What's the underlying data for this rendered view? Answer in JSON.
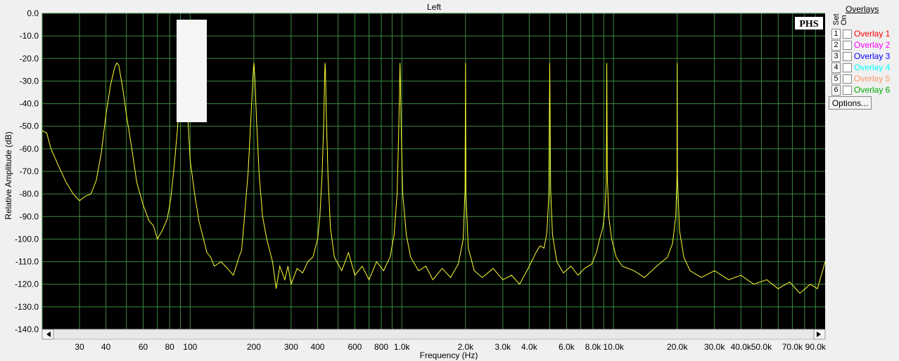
{
  "window": {
    "channel_title": "Left"
  },
  "badge": {
    "text": "PHS"
  },
  "overlays": {
    "title": "Overlays",
    "set_header": "Set",
    "on_header": "On",
    "items": [
      {
        "num": "1",
        "label": "Overlay 1",
        "color": "#ff0000"
      },
      {
        "num": "2",
        "label": "Overlay 2",
        "color": "#ff00ff"
      },
      {
        "num": "3",
        "label": "Overlay 3",
        "color": "#0000ff"
      },
      {
        "num": "4",
        "label": "Overlay 4",
        "color": "#00ffff"
      },
      {
        "num": "5",
        "label": "Overlay 5",
        "color": "#ff9966"
      },
      {
        "num": "6",
        "label": "Overlay 6",
        "color": "#00aa00"
      }
    ],
    "options_label": "Options..."
  },
  "colors": {
    "plot_bg": "#000000",
    "grid": "#3d8a3d",
    "trace": "#ffff33"
  },
  "chart_data": {
    "type": "line",
    "title": "Left",
    "xlabel": "Frequency (Hz)",
    "ylabel": "Relative Amplitude (dB)",
    "x_scale": "log",
    "xlim": [
      20,
      100000
    ],
    "ylim": [
      -140,
      0
    ],
    "grid": true,
    "yticks": [
      0,
      -10,
      -20,
      -30,
      -40,
      -50,
      -60,
      -70,
      -80,
      -90,
      -100,
      -110,
      -120,
      -130,
      -140
    ],
    "ytick_labels": [
      "0.0",
      "-10.0",
      "-20.0",
      "-30.0",
      "-40.0",
      "-50.0",
      "-60.0",
      "-70.0",
      "-80.0",
      "-90.0",
      "-100.0",
      "-110.0",
      "-120.0",
      "-130.0",
      "-140.0"
    ],
    "xticks": [
      30,
      40,
      60,
      80,
      100,
      200,
      300,
      400,
      600,
      800,
      1000,
      2000,
      3000,
      4000,
      6000,
      8000,
      10000,
      20000,
      30000,
      40000,
      50000,
      70000,
      90000
    ],
    "xtick_labels": [
      "30",
      "40",
      "60",
      "80",
      "100",
      "200",
      "300",
      "400",
      "600",
      "800",
      "1.0k",
      "2.0k",
      "3.0k",
      "4.0k",
      "6.0k",
      "8.0k",
      "10.0k",
      "20.0k",
      "30.0k",
      "40.0k",
      "50.0k",
      "70.0k",
      "90.0k"
    ],
    "series": [
      {
        "values": [
          [
            20,
            -52
          ],
          [
            21,
            -53
          ],
          [
            22,
            -60
          ],
          [
            24,
            -68
          ],
          [
            26,
            -75
          ],
          [
            28,
            -80
          ],
          [
            30,
            -83
          ],
          [
            32,
            -81
          ],
          [
            34,
            -80
          ],
          [
            36,
            -74
          ],
          [
            38,
            -62
          ],
          [
            40,
            -45
          ],
          [
            42,
            -32
          ],
          [
            44,
            -24
          ],
          [
            45,
            -22
          ],
          [
            46,
            -23
          ],
          [
            48,
            -33
          ],
          [
            50,
            -45
          ],
          [
            53,
            -60
          ],
          [
            56,
            -75
          ],
          [
            60,
            -85
          ],
          [
            64,
            -92
          ],
          [
            67,
            -94
          ],
          [
            70,
            -100
          ],
          [
            74,
            -96
          ],
          [
            78,
            -91
          ],
          [
            81,
            -82
          ],
          [
            84,
            -68
          ],
          [
            87,
            -52
          ],
          [
            89,
            -38
          ],
          [
            91,
            -25
          ],
          [
            92,
            -22
          ],
          [
            94,
            -27
          ],
          [
            97,
            -42
          ],
          [
            100,
            -65
          ],
          [
            105,
            -80
          ],
          [
            110,
            -92
          ],
          [
            115,
            -99
          ],
          [
            120,
            -106
          ],
          [
            125,
            -108
          ],
          [
            130,
            -112
          ],
          [
            140,
            -110
          ],
          [
            150,
            -113
          ],
          [
            160,
            -116
          ],
          [
            165,
            -112
          ],
          [
            170,
            -108
          ],
          [
            175,
            -105
          ],
          [
            180,
            -92
          ],
          [
            188,
            -70
          ],
          [
            194,
            -45
          ],
          [
            198,
            -28
          ],
          [
            200,
            -22
          ],
          [
            202,
            -28
          ],
          [
            206,
            -48
          ],
          [
            212,
            -72
          ],
          [
            220,
            -90
          ],
          [
            230,
            -100
          ],
          [
            245,
            -110
          ],
          [
            255,
            -122
          ],
          [
            265,
            -112
          ],
          [
            280,
            -118
          ],
          [
            290,
            -112
          ],
          [
            300,
            -120
          ],
          [
            320,
            -113
          ],
          [
            340,
            -115
          ],
          [
            360,
            -110
          ],
          [
            380,
            -108
          ],
          [
            400,
            -100
          ],
          [
            410,
            -90
          ],
          [
            420,
            -72
          ],
          [
            428,
            -48
          ],
          [
            432,
            -28
          ],
          [
            434,
            -22
          ],
          [
            436,
            -26
          ],
          [
            440,
            -45
          ],
          [
            448,
            -72
          ],
          [
            460,
            -95
          ],
          [
            480,
            -108
          ],
          [
            520,
            -114
          ],
          [
            560,
            -106
          ],
          [
            600,
            -116
          ],
          [
            650,
            -112
          ],
          [
            700,
            -118
          ],
          [
            760,
            -110
          ],
          [
            820,
            -114
          ],
          [
            880,
            -108
          ],
          [
            920,
            -98
          ],
          [
            950,
            -80
          ],
          [
            965,
            -55
          ],
          [
            975,
            -35
          ],
          [
            980,
            -22
          ],
          [
            985,
            -30
          ],
          [
            995,
            -55
          ],
          [
            1010,
            -80
          ],
          [
            1050,
            -98
          ],
          [
            1100,
            -108
          ],
          [
            1200,
            -114
          ],
          [
            1300,
            -112
          ],
          [
            1400,
            -118
          ],
          [
            1550,
            -113
          ],
          [
            1700,
            -117
          ],
          [
            1850,
            -111
          ],
          [
            1950,
            -100
          ],
          [
            1990,
            -78
          ],
          [
            2000,
            -22
          ],
          [
            2010,
            -80
          ],
          [
            2060,
            -104
          ],
          [
            2200,
            -114
          ],
          [
            2400,
            -117
          ],
          [
            2700,
            -113
          ],
          [
            3000,
            -118
          ],
          [
            3300,
            -116
          ],
          [
            3600,
            -120
          ],
          [
            3900,
            -114
          ],
          [
            4100,
            -110
          ],
          [
            4300,
            -106
          ],
          [
            4500,
            -103
          ],
          [
            4700,
            -104
          ],
          [
            4850,
            -97
          ],
          [
            4950,
            -80
          ],
          [
            5000,
            -22
          ],
          [
            5050,
            -78
          ],
          [
            5150,
            -98
          ],
          [
            5400,
            -110
          ],
          [
            5800,
            -115
          ],
          [
            6300,
            -112
          ],
          [
            6800,
            -116
          ],
          [
            7300,
            -113
          ],
          [
            7900,
            -111
          ],
          [
            8300,
            -106
          ],
          [
            8600,
            -100
          ],
          [
            8900,
            -95
          ],
          [
            9100,
            -88
          ],
          [
            9250,
            -75
          ],
          [
            9300,
            -22
          ],
          [
            9350,
            -72
          ],
          [
            9500,
            -90
          ],
          [
            9800,
            -100
          ],
          [
            10300,
            -108
          ],
          [
            11000,
            -112
          ],
          [
            12500,
            -114
          ],
          [
            14000,
            -117
          ],
          [
            16000,
            -112
          ],
          [
            18000,
            -108
          ],
          [
            19000,
            -102
          ],
          [
            19700,
            -90
          ],
          [
            19950,
            -72
          ],
          [
            20000,
            -22
          ],
          [
            20050,
            -72
          ],
          [
            20500,
            -96
          ],
          [
            21500,
            -108
          ],
          [
            23000,
            -114
          ],
          [
            26000,
            -117
          ],
          [
            30000,
            -114
          ],
          [
            35000,
            -118
          ],
          [
            40000,
            -116
          ],
          [
            46000,
            -120
          ],
          [
            53000,
            -118
          ],
          [
            60000,
            -122
          ],
          [
            68000,
            -119
          ],
          [
            76000,
            -124
          ],
          [
            85000,
            -120
          ],
          [
            92000,
            -122
          ],
          [
            100000,
            -110
          ]
        ]
      }
    ]
  }
}
